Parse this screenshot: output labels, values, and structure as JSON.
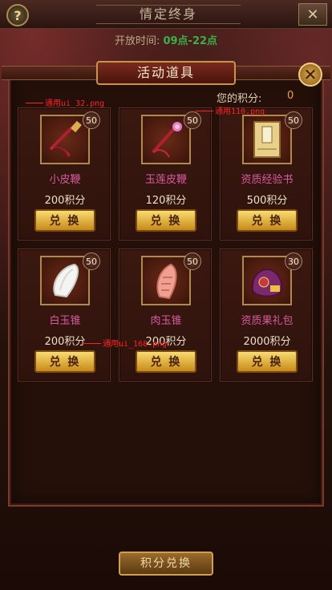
{
  "top_bar": {
    "title": "情定终身",
    "close": "✕",
    "help": "?"
  },
  "open_time": {
    "label": "开放时间:",
    "value": "09点-22点"
  },
  "modal": {
    "title": "活动道具",
    "close": "✕"
  },
  "points": {
    "label": "您的积分:",
    "value": "0"
  },
  "items": [
    {
      "name": "小皮鞭",
      "cost": "200积分",
      "badge": "50",
      "button": "兑 换",
      "icon": "whip-icon"
    },
    {
      "name": "玉莲皮鞭",
      "cost": "120积分",
      "badge": "50",
      "button": "兑 换",
      "icon": "lotus-whip-icon"
    },
    {
      "name": "资质经验书",
      "cost": "500积分",
      "badge": "50",
      "button": "兑 换",
      "icon": "book-icon"
    },
    {
      "name": "白玉锥",
      "cost": "200积分",
      "badge": "50",
      "button": "兑 换",
      "icon": "white-jade-icon"
    },
    {
      "name": "肉玉锥",
      "cost": "200积分",
      "badge": "50",
      "button": "兑 换",
      "icon": "pink-jade-icon"
    },
    {
      "name": "资质果礼包",
      "cost": "2000积分",
      "badge": "30",
      "button": "兑 换",
      "icon": "gift-bag-icon"
    }
  ],
  "annotations": [
    "通用ui_32.png",
    "通用110.png",
    "通用ui_168.png"
  ],
  "bottom": {
    "label": "积分兑换"
  }
}
